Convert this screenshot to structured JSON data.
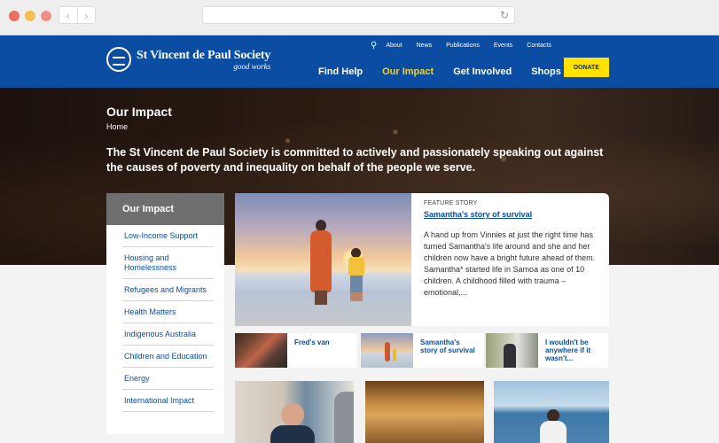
{
  "site": {
    "name": "St Vincent de Paul Society",
    "tagline": "good works"
  },
  "topnav": [
    {
      "label": "About"
    },
    {
      "label": "News"
    },
    {
      "label": "Publications"
    },
    {
      "label": "Events"
    },
    {
      "label": "Contacts"
    }
  ],
  "mainnav": [
    {
      "label": "Find Help"
    },
    {
      "label": "Our Impact"
    },
    {
      "label": "Get Involved"
    },
    {
      "label": "Shops"
    }
  ],
  "donate_label": "DONATE",
  "hero": {
    "title": "Our Impact",
    "breadcrumb": "Home",
    "lead": "The St Vincent de Paul Society is committed to actively and passionately speaking out against the causes of poverty and inequality on behalf of the people we serve."
  },
  "sidebar": {
    "heading": "Our Impact",
    "items": [
      {
        "label": "Low-Income Support"
      },
      {
        "label": "Housing and Homelessness"
      },
      {
        "label": "Refugees and Migrants"
      },
      {
        "label": "Health Matters"
      },
      {
        "label": "Indigenous Australia"
      },
      {
        "label": "Children and Education"
      },
      {
        "label": "Energy"
      },
      {
        "label": "International Impact"
      }
    ]
  },
  "feature": {
    "label": "FEATURE STORY",
    "title": "Samantha's story of survival",
    "text": "A hand up from Vinnies at just the right time has turned Samantha's life around and she and her children now have a bright future ahead of them. Samantha* started life in Samoa as one of 10 children. A childhood filled with trauma – emotional,..."
  },
  "stories": [
    {
      "title": "Fred's van"
    },
    {
      "title": "Samantha's story of survival"
    },
    {
      "title": "I wouldn't be anywhere if it wasn't..."
    }
  ],
  "colors": {
    "brand_blue": "#0a4da3",
    "accent_yellow": "#f7d11a",
    "donate_yellow": "#ffe200",
    "sidebar_head_gray": "#6f6f6f"
  }
}
